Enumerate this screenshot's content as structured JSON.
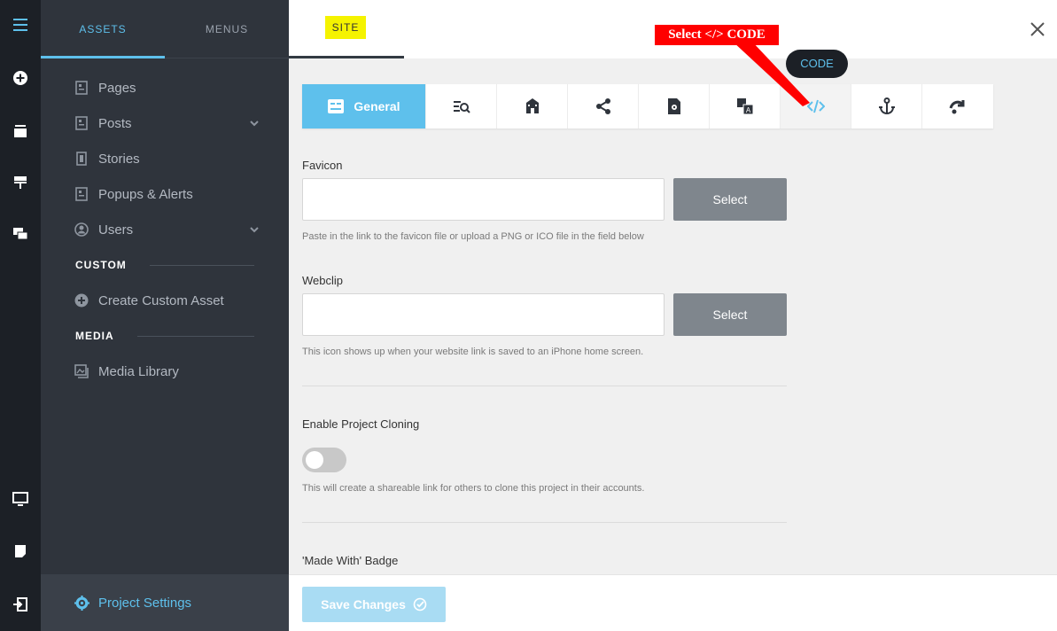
{
  "sidebar": {
    "tabs": {
      "assets": "ASSETS",
      "menus": "MENUS"
    },
    "items": [
      {
        "label": "Pages",
        "icon": "page-icon"
      },
      {
        "label": "Posts",
        "icon": "page-icon",
        "expandable": true
      },
      {
        "label": "Stories",
        "icon": "story-icon"
      },
      {
        "label": "Popups & Alerts",
        "icon": "page-icon"
      },
      {
        "label": "Users",
        "icon": "user-circle-icon",
        "expandable": true
      }
    ],
    "custom_heading": "CUSTOM",
    "create_custom_asset": "Create Custom Asset",
    "media_heading": "MEDIA",
    "media_library": "Media Library",
    "project_settings": "Project Settings"
  },
  "topbar": {
    "site_tab": "SITE"
  },
  "annotation": {
    "text": "Select </> CODE",
    "color": "#ff0000"
  },
  "tooltip": {
    "text": "CODE"
  },
  "icon_tabs": {
    "general_label": "General",
    "tabs": [
      "general-icon",
      "seo-icon",
      "school-icon",
      "share-icon",
      "file-settings-icon",
      "translate-icon",
      "code-icon",
      "anchor-icon",
      "redirect-icon"
    ],
    "active": "code-icon"
  },
  "form": {
    "favicon": {
      "label": "Favicon",
      "value": "",
      "select_label": "Select",
      "help": "Paste in the link to the favicon file or upload a PNG or ICO file in the field below"
    },
    "webclip": {
      "label": "Webclip",
      "value": "",
      "select_label": "Select",
      "help": "This icon shows up when your website link is saved to an iPhone home screen."
    },
    "cloning": {
      "label": "Enable Project Cloning",
      "enabled": false,
      "help": "This will create a shareable link for others to clone this project in their accounts."
    },
    "badge": {
      "label": "'Made With' Badge"
    }
  },
  "footer": {
    "save_label": "Save Changes"
  },
  "colors": {
    "accent": "#5ec0ec",
    "rail": "#1c2026",
    "sidebar": "#2f343c"
  }
}
